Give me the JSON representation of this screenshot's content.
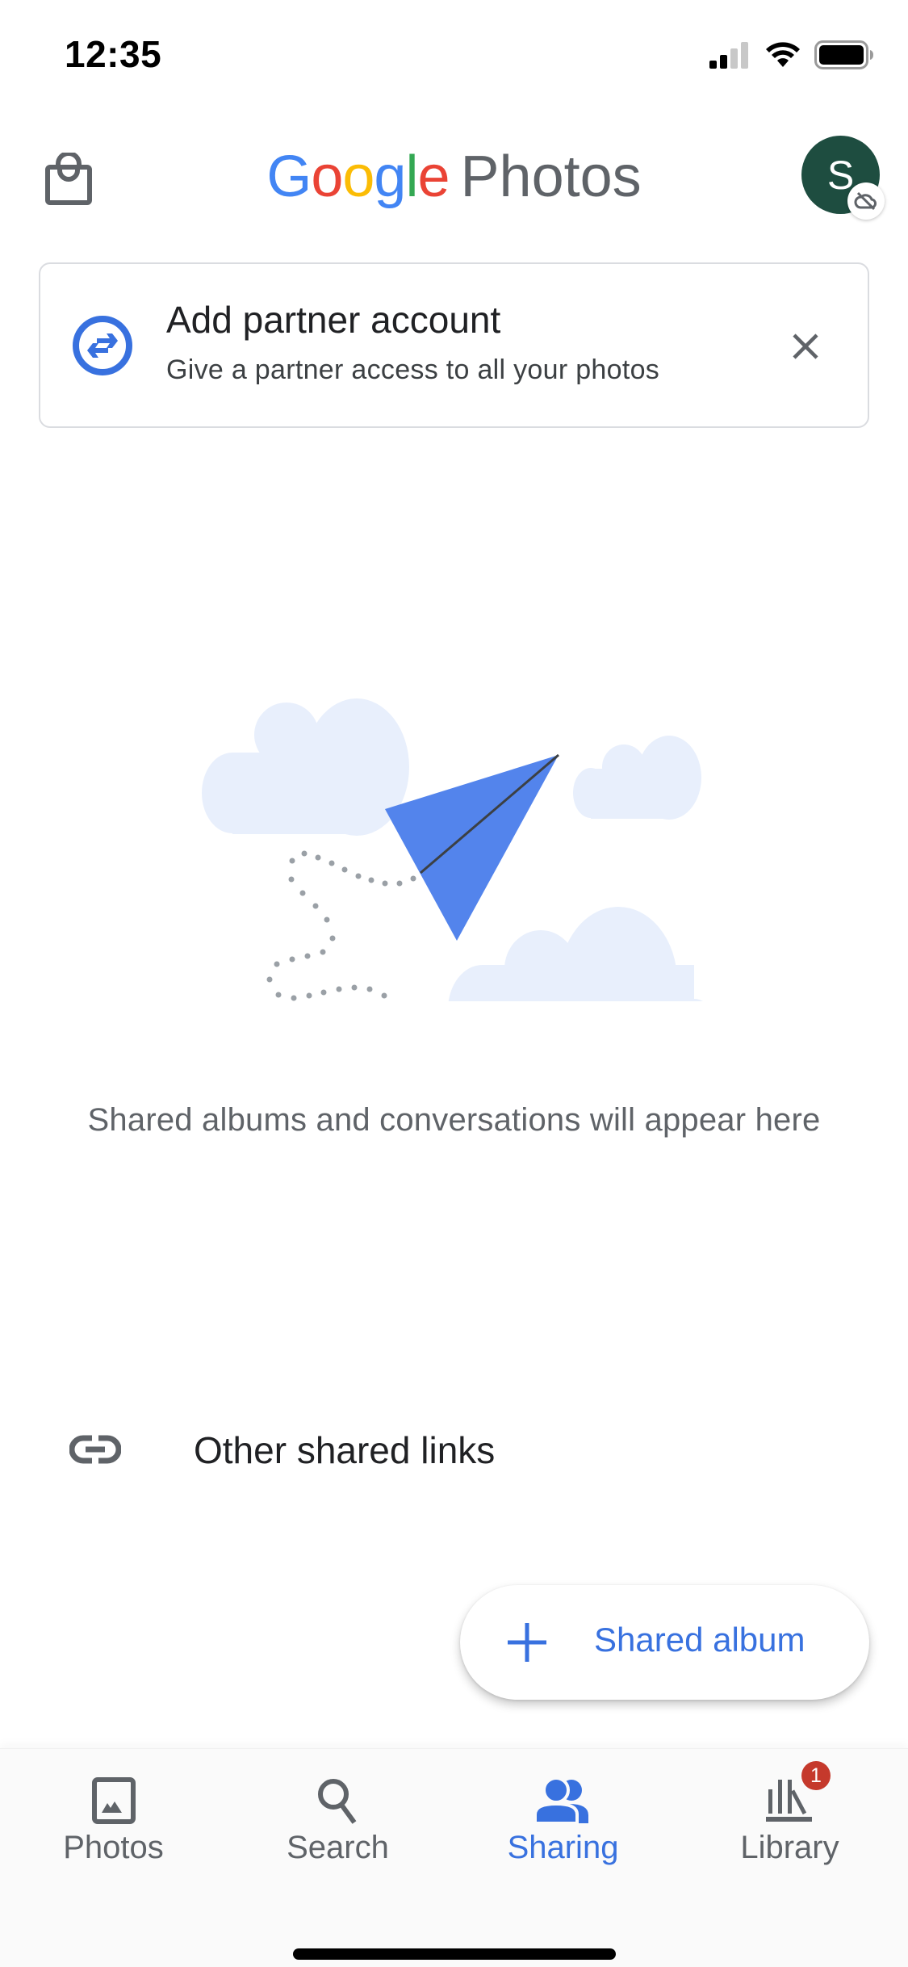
{
  "status_bar": {
    "time": "12:35",
    "signal_bars_active": 2,
    "signal_bars_total": 4,
    "wifi": "wifi-icon",
    "battery_level_percent": 100
  },
  "header": {
    "logo_google_letters": [
      "G",
      "o",
      "o",
      "g",
      "l",
      "e"
    ],
    "logo_product": "Photos",
    "left_icon": "shopping-bag-icon",
    "avatar_initial": "S",
    "avatar_color": "#1e4d40",
    "avatar_badge_icon": "cloud-off-icon"
  },
  "banner": {
    "icon": "partner-swap-icon",
    "title": "Add partner account",
    "subtitle": "Give a partner access to all your photos",
    "close_icon": "close-icon"
  },
  "empty_state": {
    "illustration": "paper-plane-with-clouds",
    "message": "Shared albums and conversations will appear here"
  },
  "links_row": {
    "icon": "link-icon",
    "label": "Other shared links"
  },
  "fab": {
    "icon": "plus-icon",
    "label": "Shared album"
  },
  "bottom_nav": {
    "items": [
      {
        "label": "Photos",
        "icon": "photo-icon",
        "active": false
      },
      {
        "label": "Search",
        "icon": "search-icon",
        "active": false
      },
      {
        "label": "Sharing",
        "icon": "people-icon",
        "active": true
      },
      {
        "label": "Library",
        "icon": "library-icon",
        "active": false,
        "badge": "1"
      }
    ]
  },
  "colors": {
    "accent": "#3871df",
    "badge": "#c5392c",
    "icon_gray": "#5f6368",
    "plane_blue": "#5384ec",
    "cloud": "#e8effc"
  }
}
